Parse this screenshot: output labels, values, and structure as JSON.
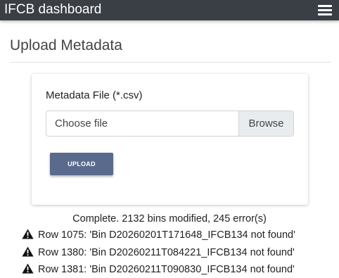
{
  "navbar": {
    "brand": "IFCB dashboard",
    "menu_icon": "hamburger-menu-icon"
  },
  "page": {
    "title": "Upload Metadata"
  },
  "form": {
    "field_label": "Metadata File (*.csv)",
    "file_placeholder": "Choose file",
    "browse_label": "Browse",
    "upload_label": "UPLOAD",
    "upload_button_color": "#5a6a8c"
  },
  "result": {
    "status": "Complete. 2132 bins modified, 245 error(s)",
    "warning_icon": "warning-triangle-icon",
    "errors": [
      "Row 1075: 'Bin D20260201T171648_IFCB134 not found'",
      "Row 1380: 'Bin D20260211T084221_IFCB134 not found'",
      "Row 1381: 'Bin D20260211T090830_IFCB134 not found'"
    ]
  }
}
